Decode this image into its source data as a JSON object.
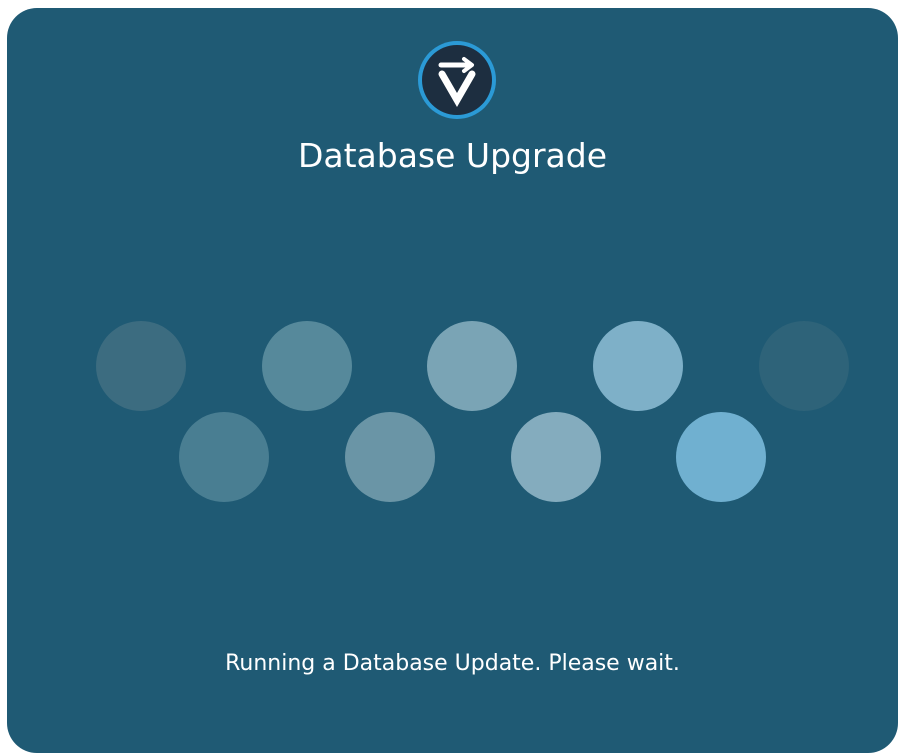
{
  "dialog": {
    "title": "Database Upgrade",
    "status_message": "Running a Database Update. Please wait.",
    "background_color": "#1f5a74"
  },
  "logo": {
    "icon": "v-logo-icon",
    "ring_color": "#2b9ad6",
    "fill_color": "#1d2e40",
    "glyph_color": "#ffffff"
  },
  "loader": {
    "icon": "loading-dots-icon",
    "dot_colors": {
      "top": [
        "#3c6c80",
        "#56899b",
        "#7aa4b5",
        "#7eb0c8",
        "#2e6379"
      ],
      "bottom": [
        "#497e92",
        "#6a95a6",
        "#84acbe",
        "#70b0d0"
      ]
    }
  }
}
